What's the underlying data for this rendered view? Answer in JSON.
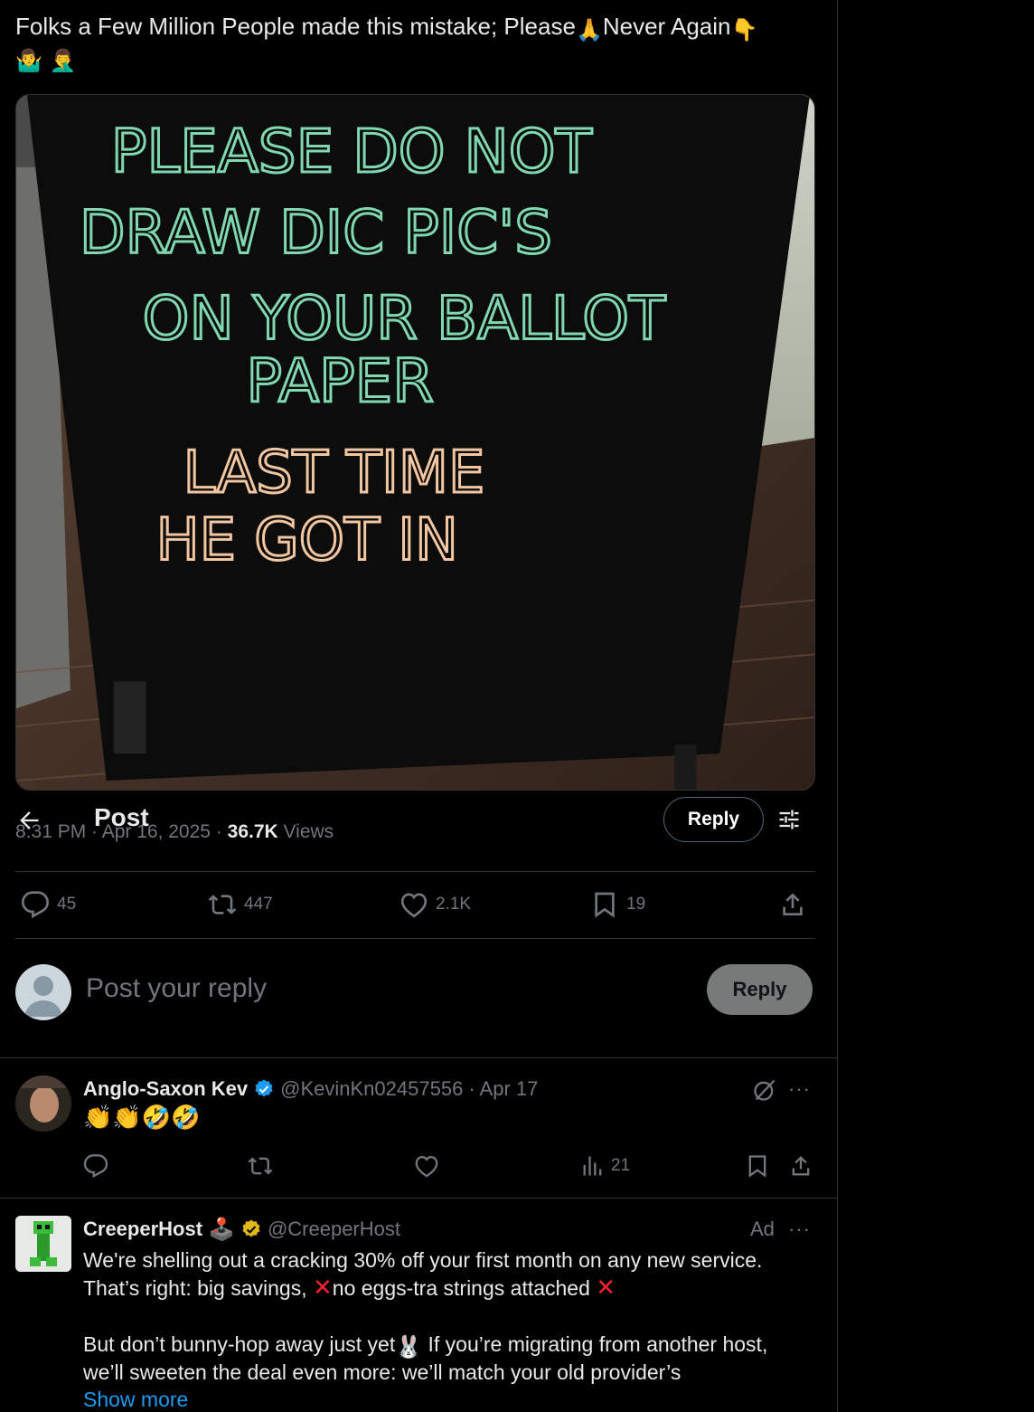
{
  "tweet": {
    "text": "Folks a Few Million People made this mistake; Please",
    "text_mid": "Never Again",
    "emoji_pray": "🙏",
    "emoji_point": "👇",
    "emoji_line2": "🤷‍♂️ 🤦‍♂️"
  },
  "media": {
    "sign_lines_green": [
      "PLEASE  DO  NOT",
      "DRAW  DIC  PIC'S",
      "ON  YOUR  BALLOT",
      "PAPER"
    ],
    "sign_lines_orange": [
      "LAST  TIME",
      "HE  GOT  IN"
    ]
  },
  "header": {
    "title": "Post",
    "reply_label": "Reply"
  },
  "meta": {
    "time": "8:31 PM · Apr 16, 2025 · ",
    "views_count": "36.7K",
    "views_label": " Views"
  },
  "stats": {
    "replies": "45",
    "reposts": "447",
    "likes": "2.1K",
    "bookmarks": "19"
  },
  "composer": {
    "placeholder": "Post your reply",
    "button": "Reply"
  },
  "reply": {
    "name": "Anglo-Saxon Kev",
    "handle": "@KevinKn02457556",
    "date": "· Apr 17",
    "body": "👏👏🤣🤣",
    "views": "21"
  },
  "ad": {
    "name": "CreeperHost",
    "name_emoji": "🕹️",
    "handle": "@CreeperHost",
    "label": "Ad",
    "line1": "We're shelling out a cracking 30% off your first month on any new service.",
    "line2a": "That’s right: big savings, ",
    "line2b": "no eggs-tra strings attached ",
    "line3a": "But don’t bunny-hop away just yet",
    "line3_emoji": "🐰",
    "line3b": " If you’re migrating from another host,",
    "line4": "we’ll sweeten the deal even more: we’ll match your old provider’s",
    "show_more": "Show more"
  },
  "colors": {
    "accent": "#1d9bf0",
    "muted": "#71767b",
    "border": "#2f3336",
    "verified_blue": "#1d9bf0",
    "verified_gold": "#e2b719",
    "chalk_green": "#7fd8b0",
    "chalk_orange": "#f2c6a0"
  }
}
